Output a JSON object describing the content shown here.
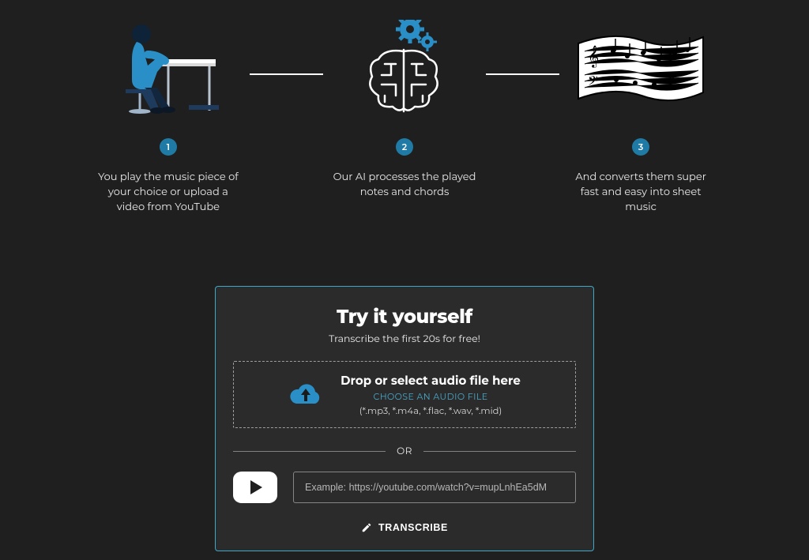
{
  "steps": [
    {
      "num": "1",
      "text": "You play the music piece of your choice or upload a video from YouTube"
    },
    {
      "num": "2",
      "text": "Our AI processes the played notes and chords"
    },
    {
      "num": "3",
      "text": "And converts them super fast and easy into sheet music"
    }
  ],
  "try": {
    "title": "Try it yourself",
    "subtitle": "Transcribe the first 20s for free!",
    "drop_title": "Drop or select audio file here",
    "choose": "CHOOSE AN AUDIO FILE",
    "formats": "(*.mp3, *.m4a, *.flac, *.wav, *.mid)",
    "or": "OR",
    "yt_placeholder": "Example: https://youtube.com/watch?v=mupLnhEa5dM",
    "transcribe": "TRANSCRIBE"
  },
  "colors": {
    "accent": "#1f7ba6",
    "panel_border": "#3fa7c8"
  }
}
